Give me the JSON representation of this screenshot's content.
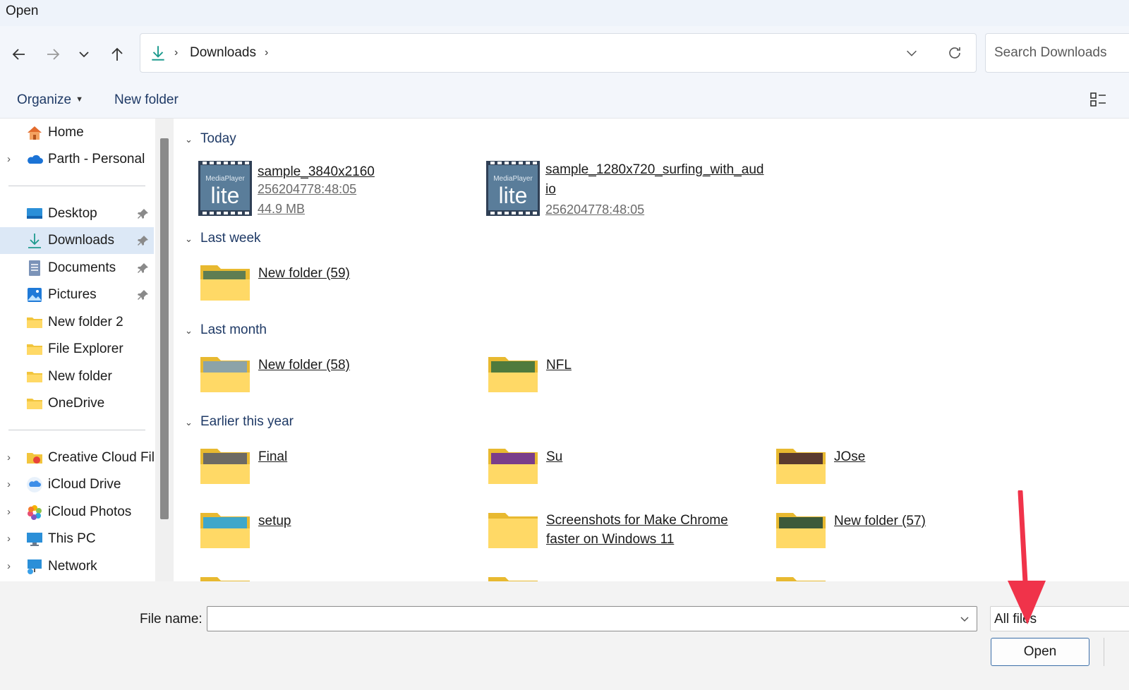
{
  "window": {
    "title": "Open"
  },
  "address": {
    "crumbs": [
      "Downloads"
    ]
  },
  "search": {
    "placeholder": "Search Downloads"
  },
  "commands": {
    "organize": "Organize",
    "new_folder": "New folder"
  },
  "sidebar": {
    "items": [
      {
        "label": "Home",
        "icon": "home-icon"
      },
      {
        "label": "Parth - Personal",
        "icon": "onedrive-cloud-icon"
      },
      {
        "label": "Desktop",
        "icon": "desktop-icon",
        "pinned": true
      },
      {
        "label": "Downloads",
        "icon": "download-icon",
        "pinned": true,
        "selected": true
      },
      {
        "label": "Documents",
        "icon": "documents-icon",
        "pinned": true
      },
      {
        "label": "Pictures",
        "icon": "pictures-icon",
        "pinned": true
      },
      {
        "label": "New folder 2",
        "icon": "folder-icon"
      },
      {
        "label": "File Explorer",
        "icon": "folder-icon"
      },
      {
        "label": "New folder",
        "icon": "folder-icon"
      },
      {
        "label": "OneDrive",
        "icon": "folder-icon"
      },
      {
        "label": "Creative Cloud Files",
        "icon": "creative-cloud-icon"
      },
      {
        "label": "iCloud Drive",
        "icon": "icloud-drive-icon"
      },
      {
        "label": "iCloud Photos",
        "icon": "icloud-photos-icon"
      },
      {
        "label": "This PC",
        "icon": "this-pc-icon"
      },
      {
        "label": "Network",
        "icon": "network-icon"
      }
    ]
  },
  "groups": {
    "today": {
      "label": "Today",
      "files": [
        {
          "name": "sample_3840x2160",
          "meta1": "256204778:48:05",
          "meta2": "44.9 MB"
        },
        {
          "name_line1": "sample_1280x720_surfing_with_aud",
          "name_line2": "io",
          "meta1": "256204778:48:05"
        }
      ]
    },
    "last_week": {
      "label": "Last week",
      "folders": [
        "New folder (59)"
      ]
    },
    "last_month": {
      "label": "Last month",
      "folders": [
        "New folder (58)",
        "NFL"
      ]
    },
    "earlier": {
      "label": "Earlier this year",
      "folders": [
        "Final",
        "Su",
        "JOse",
        "setup",
        "New folder (57)"
      ],
      "long_folder": {
        "line1": "Screenshots for Make Chrome",
        "line2": "faster on Windows 11"
      }
    }
  },
  "footer": {
    "file_name_label": "File name:",
    "file_name_value": "",
    "filter": "All files",
    "open_label": "Open"
  },
  "colors": {
    "accent": "#1f3a66",
    "selected": "#dce8f6",
    "annotation_arrow": "#f0334a"
  }
}
